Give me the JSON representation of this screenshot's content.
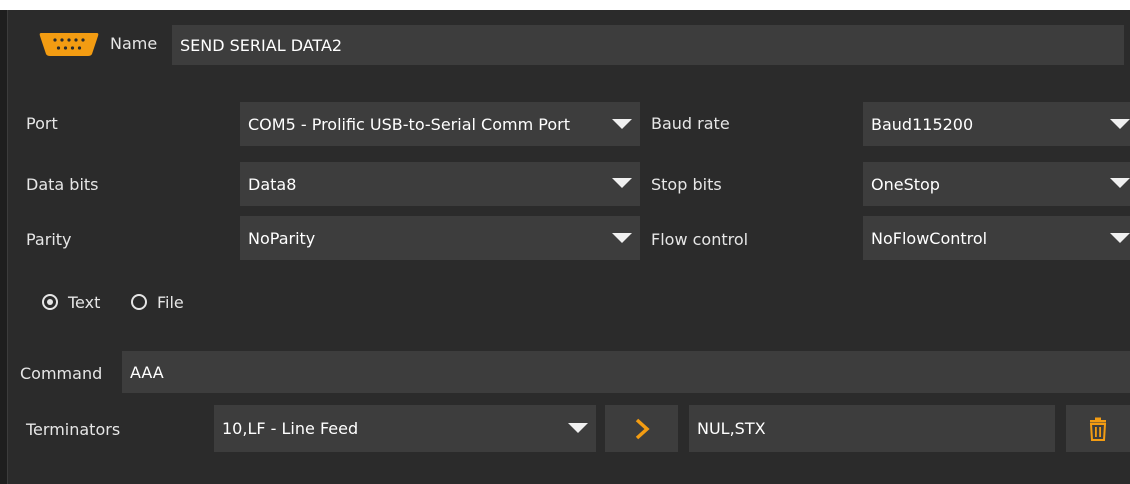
{
  "header": {
    "name_label": "Name",
    "name_value": "SEND SERIAL DATA2",
    "icon": "serial-port-icon",
    "accent": "#f39c12"
  },
  "settings": {
    "port": {
      "label": "Port",
      "value": "COM5 - Prolific USB-to-Serial Comm Port"
    },
    "baud_rate": {
      "label": "Baud rate",
      "value": "Baud115200"
    },
    "data_bits": {
      "label": "Data bits",
      "value": "Data8"
    },
    "stop_bits": {
      "label": "Stop bits",
      "value": "OneStop"
    },
    "parity": {
      "label": "Parity",
      "value": "NoParity"
    },
    "flow_control": {
      "label": "Flow control",
      "value": "NoFlowControl"
    }
  },
  "mode": {
    "text_label": "Text",
    "file_label": "File",
    "selected": "Text"
  },
  "command": {
    "label": "Command",
    "value": "AAA"
  },
  "terminators": {
    "label": "Terminators",
    "selected": "10,LF - Line Feed",
    "add_icon": "chevron-right-icon",
    "list_value": "NUL,STX",
    "delete_icon": "trash-icon"
  }
}
